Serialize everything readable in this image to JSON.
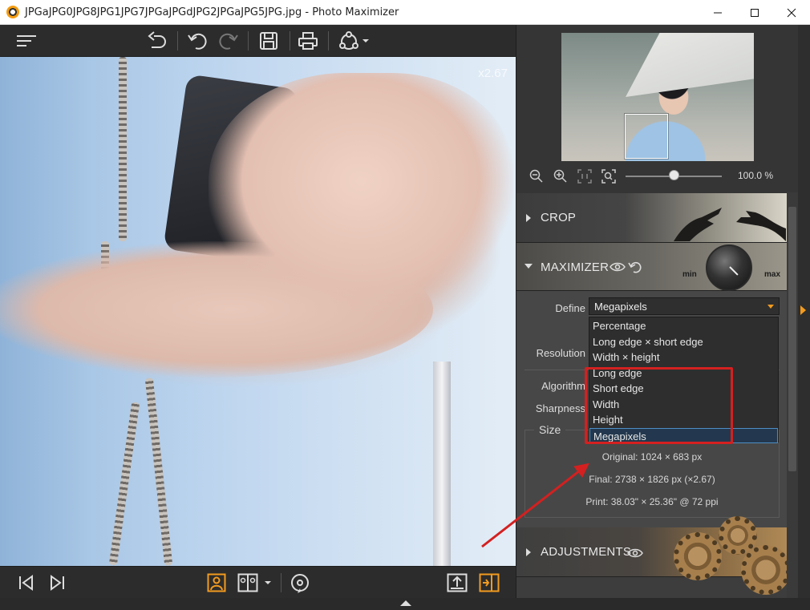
{
  "window": {
    "title": "JPGaJPG0JPG8JPG1JPG7JPGaJPGdJPG2JPGaJPG5JPG.jpg - Photo Maximizer",
    "controls": [
      "minimize-icon",
      "maximize-icon",
      "close-icon"
    ]
  },
  "toolbar": {
    "icons": [
      "menu-icon",
      "undo-all-icon",
      "undo-icon",
      "redo-icon",
      "save-icon",
      "print-icon",
      "share-icon"
    ]
  },
  "canvas": {
    "zoom_factor": "x2.67"
  },
  "navigator": {
    "zoom_percent": "100.0 %",
    "zoom_slider_value": 0.5,
    "icons": [
      "zoom-out-icon",
      "zoom-in-icon",
      "actual-size-icon",
      "fit-screen-icon"
    ]
  },
  "sections": {
    "crop": {
      "title": "CROP"
    },
    "maximizer": {
      "title": "MAXIMIZER",
      "knob_min": "min",
      "knob_max": "max",
      "define_label": "Define",
      "define_value": "Megapixels",
      "resolution_label": "Resolution",
      "algorithm_label": "Algorithm",
      "sharpness_label": "Sharpness",
      "size": {
        "title": "Size",
        "original": "Original: 1024 × 683 px",
        "final": "Final: 2738 × 1826 px (×2.67)",
        "print": "Print: 38.03\" × 25.36\" @ 72 ppi"
      }
    },
    "adjustments": {
      "title": "ADJUSTMENTS"
    }
  },
  "define_options": [
    "Percentage",
    "Long edge × short edge",
    "Width × height",
    "Long edge",
    "Short edge",
    "Width",
    "Height",
    "Megapixels"
  ],
  "define_selected_index": 7,
  "bottombar": {
    "icons": [
      "previous-image-icon",
      "next-image-icon",
      "single-view-icon",
      "compare-view-icon",
      "view-mode-dropdown-icon",
      "rotate-icon",
      "export-icon",
      "split-view-icon"
    ]
  },
  "colors": {
    "accent": "#f29b1f",
    "annotation_red": "#d42020",
    "selection": "#4d8dc5"
  }
}
